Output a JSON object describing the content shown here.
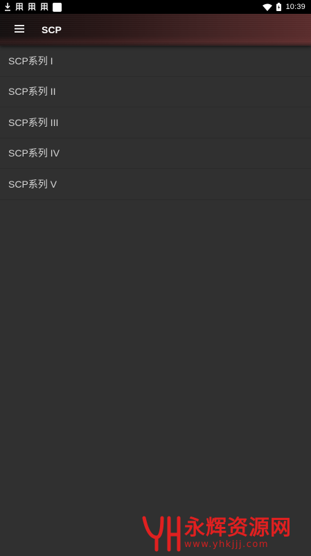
{
  "status_bar": {
    "time": "10:39",
    "left_icons": [
      "download-icon",
      "bug-icon",
      "bug-icon",
      "bug-icon",
      "square-notification-icon"
    ],
    "right_icons": [
      "wifi-icon",
      "battery-icon"
    ]
  },
  "app_bar": {
    "menu_icon": "hamburger-icon",
    "title": "SCP"
  },
  "list": {
    "items": [
      {
        "label": "SCP系列 I"
      },
      {
        "label": "SCP系列 II"
      },
      {
        "label": "SCP系列 III"
      },
      {
        "label": "SCP系列 IV"
      },
      {
        "label": "SCP系列 V"
      }
    ]
  },
  "watermark": {
    "title": "永辉资源网",
    "url": "www.yhkjjj.com",
    "color": "#e02020"
  },
  "colors": {
    "background": "#303030",
    "text": "#d6d6d6",
    "status_bar": "#000000"
  }
}
